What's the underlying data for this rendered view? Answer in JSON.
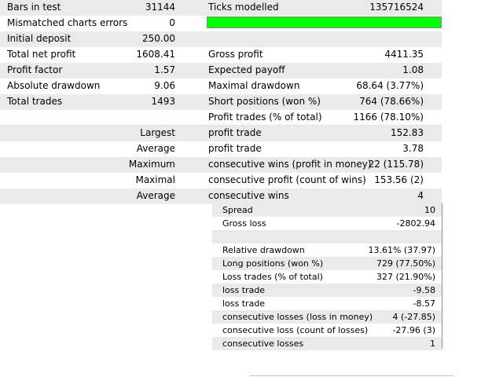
{
  "report": {
    "rows": [
      {
        "label": "Bars in test",
        "value": "31144",
        "label2": "Ticks modelled",
        "value2": "135716524"
      },
      {
        "label": "Mismatched charts errors",
        "value": "0",
        "label2": "",
        "value2": ""
      },
      {
        "label": "Initial deposit",
        "value": "250.00",
        "label2": "",
        "value2": ""
      },
      {
        "label": "Total net profit",
        "value": "1608.41",
        "label2": "Gross profit",
        "value2": "4411.35"
      },
      {
        "label": "Profit factor",
        "value": "1.57",
        "label2": "Expected payoff",
        "value2": "1.08"
      },
      {
        "label": "Absolute drawdown",
        "value": "9.06",
        "label2": "Maximal drawdown",
        "value2": "68.64 (3.77%)"
      },
      {
        "label": "Total trades",
        "value": "1493",
        "label2": "Short positions (won %)",
        "value2": "764 (78.66%)"
      },
      {
        "label": "",
        "value": "",
        "label2": "Profit trades (% of total)",
        "value2": "1166 (78.10%)"
      },
      {
        "label": "",
        "value": "Largest",
        "label2": "profit trade",
        "value2": "152.83"
      },
      {
        "label": "",
        "value": "Average",
        "label2": "profit trade",
        "value2": "3.78"
      },
      {
        "label": "",
        "value": "Maximum",
        "label2": "consecutive wins (profit in money)",
        "value2": "22 (115.78)"
      },
      {
        "label": "",
        "value": "Maximal",
        "label2": "consecutive profit (count of wins)",
        "value2": "153.56 (2)"
      },
      {
        "label": "",
        "value": "Average",
        "label2": "consecutive wins",
        "value2": "4"
      }
    ],
    "modelling_quality_color": "#00ff00"
  },
  "panel": {
    "rows": [
      {
        "label": "Spread",
        "value": "10"
      },
      {
        "label": "Gross loss",
        "value": "-2802.94"
      },
      {
        "label": "",
        "value": ""
      },
      {
        "label": "Relative drawdown",
        "value": "13.61% (37.97)"
      },
      {
        "label": "Long positions (won %)",
        "value": "729 (77.50%)"
      },
      {
        "label": "Loss trades (% of total)",
        "value": "327 (21.90%)"
      },
      {
        "label": "loss trade",
        "value": "-9.58"
      },
      {
        "label": "loss trade",
        "value": "-8.57"
      },
      {
        "label": "consecutive losses (loss in money)",
        "value": "4 (-27.85)"
      },
      {
        "label": "consecutive loss (count of losses)",
        "value": "-27.96 (3)"
      },
      {
        "label": "consecutive losses",
        "value": "1"
      }
    ]
  }
}
